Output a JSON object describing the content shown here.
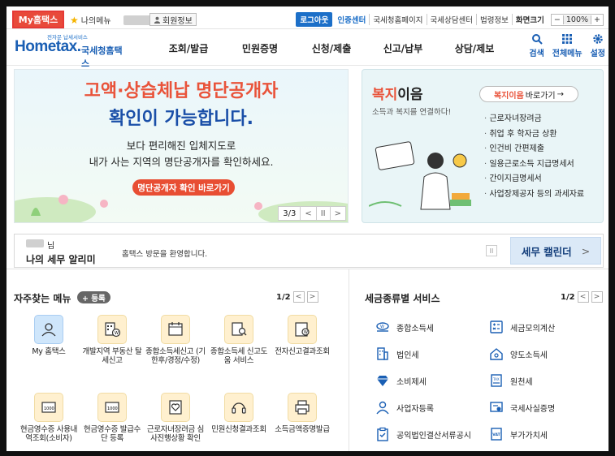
{
  "topbar": {
    "my_hometax": "My홈택스",
    "my_menu": "나의메뉴",
    "member_info": "회원정보",
    "logout": "로그아웃",
    "cert_center": "인증센터",
    "links": [
      "국세청홈페이지",
      "국세상담센터",
      "법령정보"
    ],
    "screen_size": "화면크기",
    "zoom_minus": "−",
    "zoom_value": "100%",
    "zoom_plus": "+"
  },
  "header": {
    "logo_sub": "전자문 납세서비스",
    "logo_main": "Hometax.",
    "logo_kr": "국세청홈택스",
    "nav": [
      "조회/발급",
      "민원증명",
      "신청/제출",
      "신고/납부",
      "상담/제보"
    ],
    "icons": [
      {
        "label": "검색",
        "icon": "search-icon"
      },
      {
        "label": "전체메뉴",
        "icon": "grid-icon"
      },
      {
        "label": "설정",
        "icon": "gear-icon"
      }
    ]
  },
  "banner": {
    "title1": "고액·상습체납 명단공개자",
    "title2": "확인이 가능합니다.",
    "sub1": "보다 편리해진 입체지도로",
    "sub2": "내가 사는 지역의 명단공개자를 확인하세요.",
    "button": "명단공개자 확인 바로가기",
    "pager": "3/3",
    "prev": "<",
    "pause": "II",
    "next": ">"
  },
  "welfare": {
    "title_acc": "복지",
    "title_rest": "이음",
    "desc": "소득과 복지를 연결하다!",
    "go_acc": "복지이음",
    "go_rest": "바로가기",
    "go_arrow": "→",
    "items": [
      "근로자녀장려금",
      "취업 후 학자금 상환",
      "인건비 간편제출",
      "일용근로소득 지급명세서",
      "간이지급명세서",
      "사업장제공자 등의 과세자료"
    ]
  },
  "alert": {
    "nim": "님",
    "title": "나의 세무 알리미",
    "message": "홈택스 방문을 환영합니다.",
    "pause": "II",
    "calendar": "세무 캘린더",
    "arrow": ">"
  },
  "favorites": {
    "title": "자주찾는 메뉴",
    "register": "+ 등록",
    "page": "1/2",
    "prev": "<",
    "next": ">",
    "items": [
      "My 홈택스",
      "개발지역 부동산 탈세신고",
      "종합소득세신고 (기한후/경정/수정)",
      "종합소득세 신고도움 서비스",
      "전자신고결과조회",
      "현금영수증 사용내역조회(소비자)",
      "현금영수증 발급수단 등록",
      "근로자녀장려금 심사진행상황 확인",
      "민원신청결과조회",
      "소득금액증명발급"
    ]
  },
  "taxes": {
    "title": "세금종류별 서비스",
    "page": "1/2",
    "prev": "<",
    "next": ">",
    "items": [
      "종합소득세",
      "세금모의계산",
      "법인세",
      "양도소득세",
      "소비제세",
      "원천세",
      "사업자등록",
      "국세사실증명",
      "공익법인결산서류공시",
      "부가가치세"
    ]
  },
  "colors": {
    "brand_blue": "#1a5fb4",
    "accent_red": "#e84e33"
  }
}
